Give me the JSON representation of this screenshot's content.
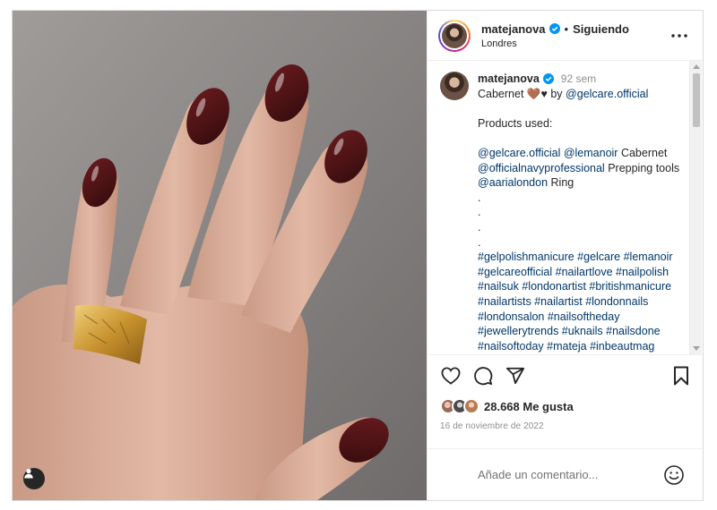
{
  "post": {
    "username": "matejanova",
    "separator": "•",
    "follow_state": "Siguiendo",
    "location": "Londres",
    "more_icon": "more-options-icon"
  },
  "caption": {
    "username": "matejanova",
    "time_ago": "92 sem",
    "line1_text": "Cabernet 🤎♥ by",
    "line1_mention": "@gelcare.official",
    "products_heading": "Products used:",
    "product_line1_mentions": "@gelcare.official @lemanoir",
    "product_line1_text": "Cabernet",
    "product_line2_mention": "@officialnavyprofessional",
    "product_line2_text": "Prepping tools",
    "product_line3_mention": "@aarialondon",
    "product_line3_text": "Ring",
    "dots": [
      ".",
      ".",
      ".",
      "."
    ],
    "hashtags": "#gelpolishmanicure #gelcare #lemanoir #gelcareofficial #nailartlove #nailpolish #nailsuk #londonartist #britishmanicure #nailartists #nailartist #londonnails #londonsalon #nailsoftheday #jewellerytrends #uknails #nailsdone #nailsoftoday #mateja #inbeautmag"
  },
  "actions": {
    "like_icon": "heart-icon",
    "comment_icon": "comment-icon",
    "share_icon": "share-icon",
    "save_icon": "bookmark-icon"
  },
  "likes": {
    "count_label": "28.668 Me gusta"
  },
  "date": "16 de noviembre de 2022",
  "comment": {
    "placeholder": "Añade un comentario...",
    "emoji_icon": "emoji-icon"
  },
  "colors": {
    "link": "#00376b",
    "verified": "#0095f6",
    "muted": "#8e8e8e",
    "nail_polish": "#4a1214"
  }
}
